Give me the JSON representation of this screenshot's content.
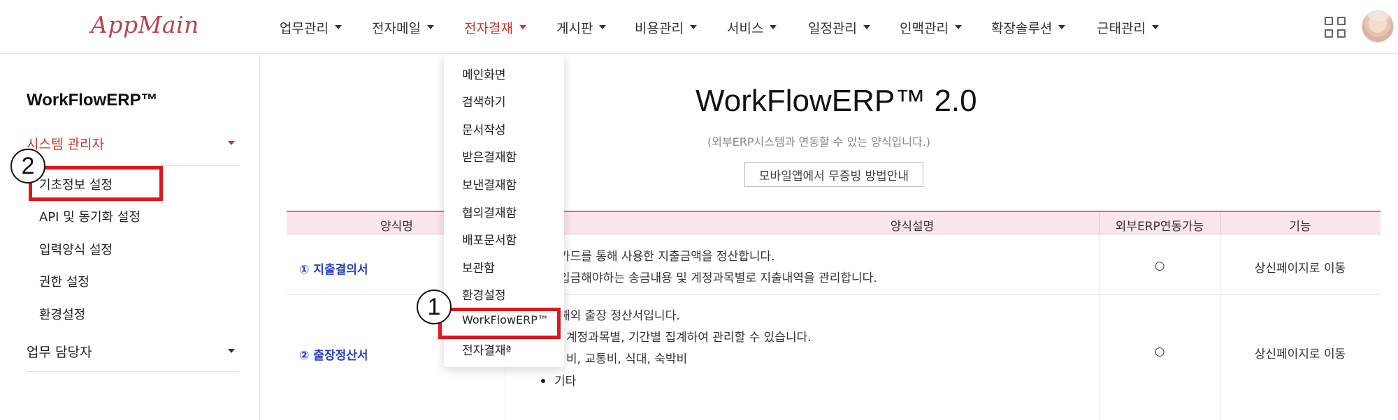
{
  "header": {
    "logo_text": "AppMain",
    "nav": [
      {
        "label": "업무관리"
      },
      {
        "label": "전자메일"
      },
      {
        "label": "전자결재",
        "active": true
      },
      {
        "label": "게시판"
      },
      {
        "label": "비용관리"
      },
      {
        "label": "서비스"
      },
      {
        "label": "일정관리"
      },
      {
        "label": "인맥관리"
      },
      {
        "label": "확장솔루션"
      },
      {
        "label": "근태관리"
      }
    ],
    "apps_icon": "grid-apps-icon",
    "avatar_icon": "user-avatar"
  },
  "sidebar": {
    "title": "WorkFlowERP™",
    "groups": [
      {
        "label": "시스템 관리자",
        "open": true,
        "items": [
          "기초정보 설정",
          "API 및 동기화 설정",
          "입력양식 설정",
          "권한 설정",
          "환경설정"
        ]
      },
      {
        "label": "업무 담당자",
        "open": false
      }
    ]
  },
  "main": {
    "title": "WorkFlowERP™ 2.0",
    "subtitle": "(외부ERP시스템과 연동할 수 있는 양식입니다.)",
    "mobile_button": "모바일앱에서 무증빙 방법안내",
    "table": {
      "headers": [
        "양식명",
        "양식설명",
        "외부ERP연동가능",
        "기능"
      ],
      "rows": [
        {
          "name": "① 지출결의서",
          "desc": [
            "카드를 통해 사용한 지출금액을 정산합니다.",
            "입금해야하는 송금내용 및 계정과목별로 지출내역을 관리합니다."
          ],
          "erp": "○",
          "action": "상신페이지로 이동"
        },
        {
          "name": "② 출장정산서",
          "desc": [
            "해외 출장 정산서입니다.",
            "계정과목별, 기간별 집계하여 관리할 수 있습니다.",
            "비, 교통비, 식대, 숙박비",
            "기타"
          ],
          "erp": "○",
          "action": "상신페이지로 이동"
        }
      ]
    }
  },
  "dropdown": {
    "items": [
      "메인화면",
      "검색하기",
      "문서작성",
      "받은결재함",
      "보낸결재함",
      "협의결재함",
      "배포문서함",
      "보관함",
      "환경설정",
      "WorkFlowERP™",
      "전자결재ª"
    ]
  },
  "annotations": {
    "marker_1": "1",
    "marker_2": "2",
    "mark_color": "#e0161e"
  },
  "colors": {
    "accent": "#c0392b",
    "link": "#2a3fc0",
    "header_bg": "#fbe7ea"
  }
}
